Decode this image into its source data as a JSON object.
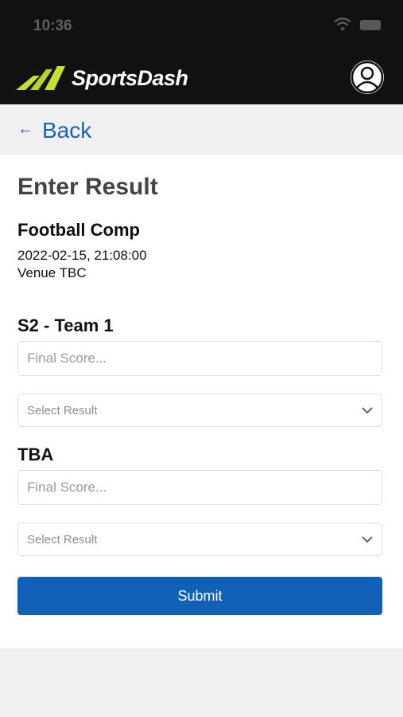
{
  "status_bar": {
    "time": "10:36"
  },
  "header": {
    "brand": "SportsDash",
    "logo_colors": [
      "#c8e02a",
      "#8fbf1f"
    ],
    "profile_icon": "user-circle-icon"
  },
  "nav": {
    "back_label": "Back",
    "back_icon": "arrow-left-icon"
  },
  "form": {
    "title": "Enter Result",
    "competition": "Football Comp",
    "datetime": "2022-02-15, 21:08:00",
    "venue": "Venue TBC",
    "teams": [
      {
        "name": "S2 - Team 1",
        "score_placeholder": "Final Score...",
        "result_value": "Select Result"
      },
      {
        "name": "TBA",
        "score_placeholder": "Final Score...",
        "result_value": "Select Result"
      }
    ],
    "submit_label": "Submit"
  },
  "colors": {
    "accent": "#1060b8",
    "link": "#1a62b4",
    "header_bg": "#111111"
  }
}
